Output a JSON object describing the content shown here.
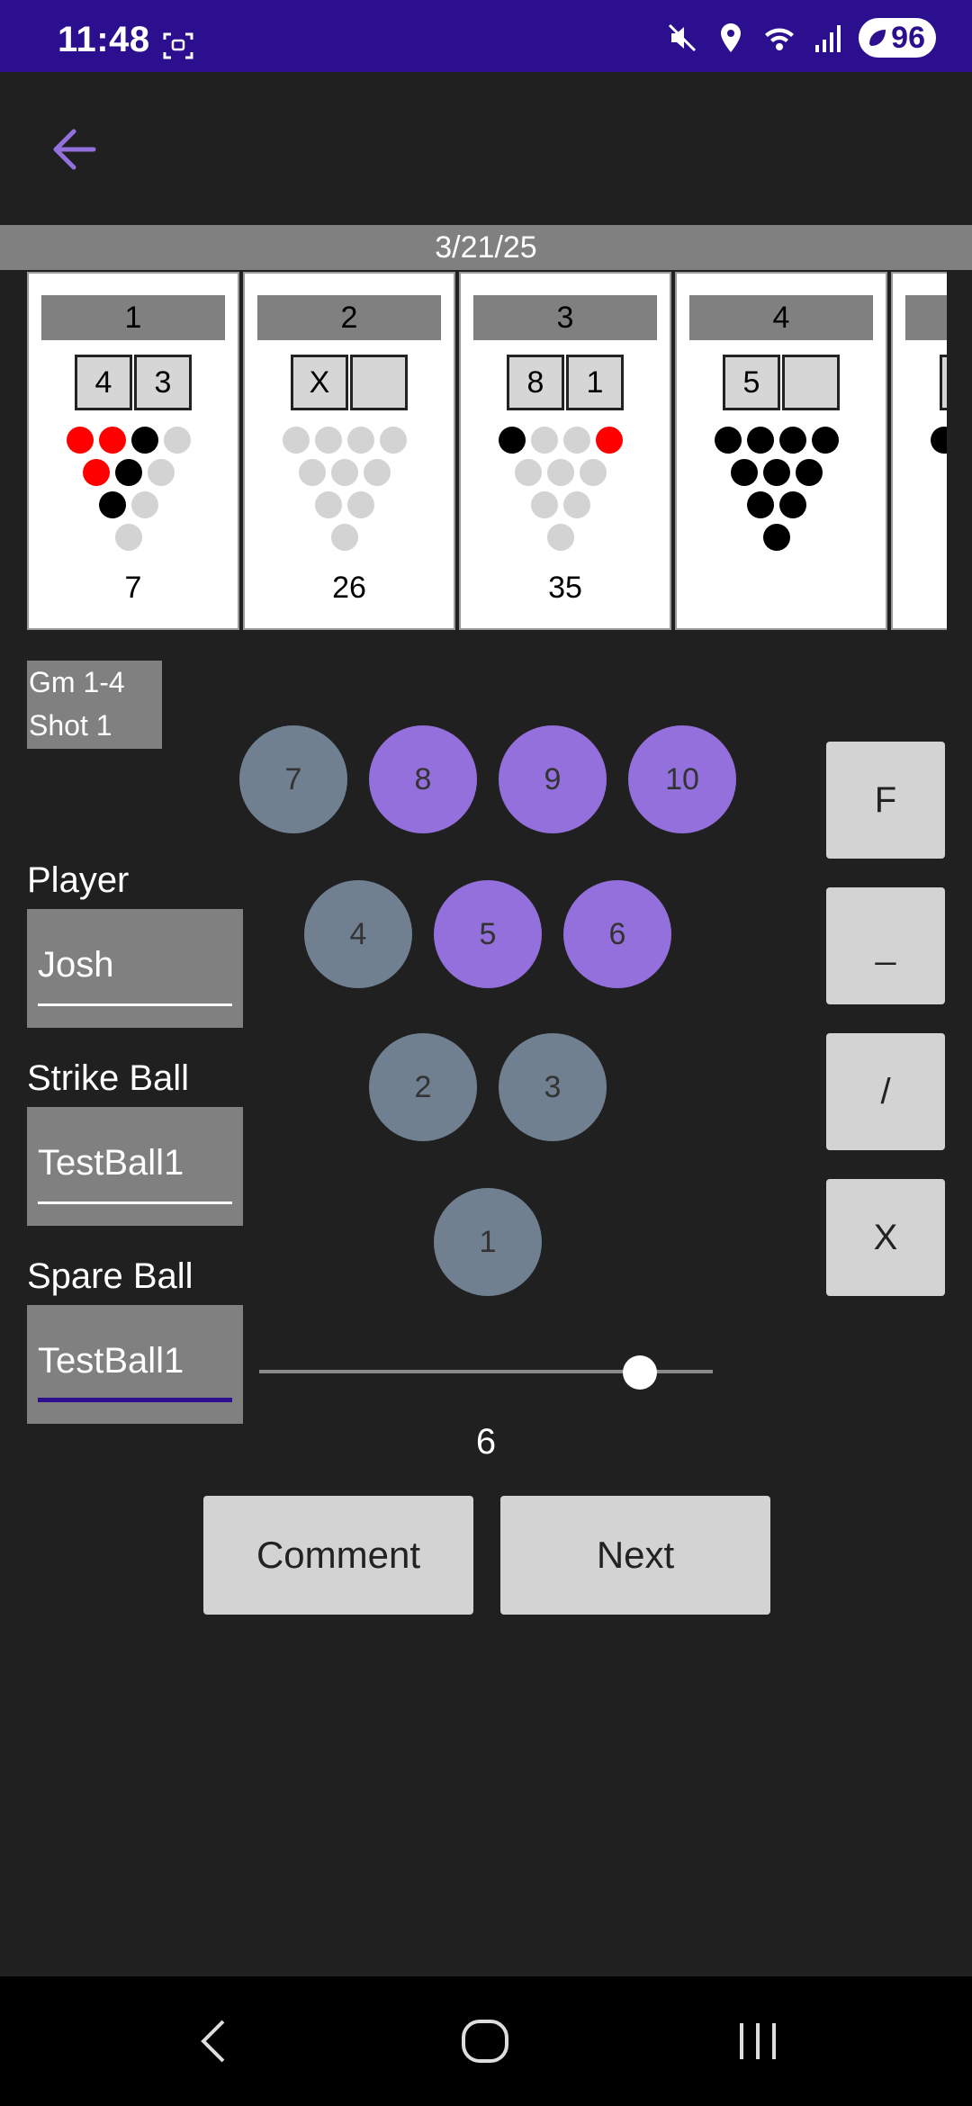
{
  "status_bar": {
    "time": "11:48",
    "battery": "96",
    "icons": [
      "screenshot-icon",
      "mute-icon",
      "location-icon",
      "wifi-icon",
      "signal-icon",
      "battery-saver-icon"
    ]
  },
  "app_bar": {
    "back_icon": "back-arrow-icon"
  },
  "date": "3/21/25",
  "frames": [
    {
      "number": "1",
      "ball1": "4",
      "ball2": "3",
      "total": "7",
      "pins": {
        "7": "red",
        "8": "red",
        "9": "standing",
        "10": "down",
        "4": "red",
        "5": "standing",
        "6": "down",
        "2": "standing",
        "3": "down",
        "1": "down"
      }
    },
    {
      "number": "2",
      "ball1": "X",
      "ball2": "",
      "total": "26",
      "pins": {
        "7": "down",
        "8": "down",
        "9": "down",
        "10": "down",
        "4": "down",
        "5": "down",
        "6": "down",
        "2": "down",
        "3": "down",
        "1": "down"
      }
    },
    {
      "number": "3",
      "ball1": "8",
      "ball2": "1",
      "total": "35",
      "pins": {
        "7": "standing",
        "8": "down",
        "9": "down",
        "10": "red",
        "4": "down",
        "5": "down",
        "6": "down",
        "2": "down",
        "3": "down",
        "1": "down"
      }
    },
    {
      "number": "4",
      "ball1": "5",
      "ball2": "",
      "total": "",
      "pins": {
        "7": "standing",
        "8": "standing",
        "9": "standing",
        "10": "standing",
        "4": "standing",
        "5": "standing",
        "6": "standing",
        "2": "standing",
        "3": "standing",
        "1": "standing"
      }
    }
  ],
  "game_shot": {
    "line1": "Gm 1-4",
    "line2": "Shot 1"
  },
  "fields": {
    "player_label": "Player",
    "player_value": "Josh",
    "strike_label": "Strike Ball",
    "strike_value": "TestBall1",
    "spare_label": "Spare Ball",
    "spare_value": "TestBall1"
  },
  "pin_buttons": [
    {
      "label": "7",
      "state": "up"
    },
    {
      "label": "8",
      "state": "selected"
    },
    {
      "label": "9",
      "state": "selected"
    },
    {
      "label": "10",
      "state": "selected"
    },
    {
      "label": "4",
      "state": "up"
    },
    {
      "label": "5",
      "state": "selected"
    },
    {
      "label": "6",
      "state": "selected"
    },
    {
      "label": "2",
      "state": "up"
    },
    {
      "label": "3",
      "state": "up"
    },
    {
      "label": "1",
      "state": "up"
    }
  ],
  "mark_buttons": {
    "foul": "F",
    "gutter": "_",
    "spare": "/",
    "strike": "X"
  },
  "slider": {
    "value": "6",
    "fraction": 0.84
  },
  "buttons": {
    "comment": "Comment",
    "next": "Next"
  },
  "colors": {
    "status_bar": "#2c0f8e",
    "background": "#202020",
    "pin_up": "#708090",
    "pin_selected": "#9370db",
    "pin_red": "#ff0000",
    "accent": "#9370db"
  },
  "nav": {
    "back": "nav-back-icon",
    "home": "nav-home-icon",
    "recents": "nav-recents-icon"
  }
}
